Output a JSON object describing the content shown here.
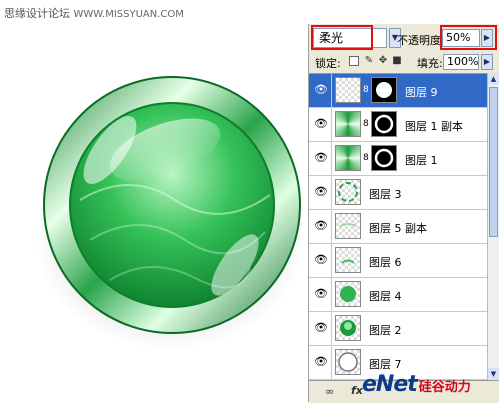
{
  "watermark": {
    "text": "思缘设计论坛",
    "site": "WWW.MISSYUAN.COM"
  },
  "panel": {
    "blend_mode": "柔光",
    "opacity_label": "不透明度:",
    "opacity_value": "50%",
    "lock_label": "锁定:",
    "fill_label": "填充:",
    "fill_value": "100%",
    "layers": [
      {
        "name": "图层 9",
        "selected": true,
        "has_mask": true
      },
      {
        "name": "图层 1 副本",
        "selected": false,
        "has_mask": true
      },
      {
        "name": "图层 1",
        "selected": false,
        "has_mask": true
      },
      {
        "name": "图层 3",
        "selected": false,
        "has_mask": false
      },
      {
        "name": "图层 5 副本",
        "selected": false,
        "has_mask": false
      },
      {
        "name": "图层 6",
        "selected": false,
        "has_mask": false
      },
      {
        "name": "图层 4",
        "selected": false,
        "has_mask": false
      },
      {
        "name": "图层 2",
        "selected": false,
        "has_mask": false
      },
      {
        "name": "图层 7",
        "selected": false,
        "has_mask": false
      }
    ]
  },
  "logo": {
    "main": "eNet",
    "cn": "硅谷动力"
  },
  "colors": {
    "green_dark": "#0a7a2a",
    "green_light": "#6fe08a",
    "selection": "#3169c6",
    "highlight_box": "#e01010"
  }
}
